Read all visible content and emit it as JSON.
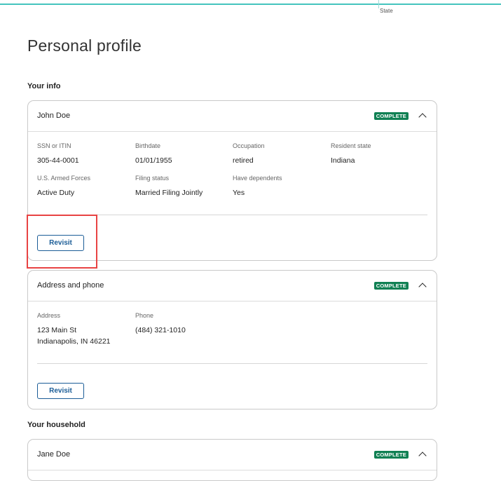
{
  "header": {
    "state_label": "State"
  },
  "page_title": "Personal profile",
  "sections": {
    "your_info": "Your info",
    "your_household": "Your household"
  },
  "cards": {
    "john": {
      "title": "John Doe",
      "badge": "COMPLETE",
      "fields": [
        {
          "label": "SSN or ITIN",
          "value": "305-44-0001"
        },
        {
          "label": "Birthdate",
          "value": "01/01/1955"
        },
        {
          "label": "Occupation",
          "value": "retired"
        },
        {
          "label": "Resident state",
          "value": "Indiana"
        },
        {
          "label": "U.S. Armed Forces",
          "value": "Active Duty"
        },
        {
          "label": "Filing status",
          "value": "Married Filing Jointly"
        },
        {
          "label": "Have dependents",
          "value": "Yes"
        }
      ],
      "revisit_label": "Revisit"
    },
    "address": {
      "title": "Address and phone",
      "badge": "COMPLETE",
      "fields": [
        {
          "label": "Address",
          "value_line1": "123 Main St",
          "value_line2": "Indianapolis, IN 46221"
        },
        {
          "label": "Phone",
          "value": "(484) 321-1010"
        }
      ],
      "revisit_label": "Revisit"
    },
    "household": {
      "title": "Jane Doe",
      "badge": "COMPLETE"
    }
  },
  "icons": {
    "expand": "chevron-up-icon"
  },
  "colors": {
    "badge": "#108053",
    "button": "#1a5c96",
    "highlight": "#e84343",
    "accent_line": "#44c4be"
  }
}
